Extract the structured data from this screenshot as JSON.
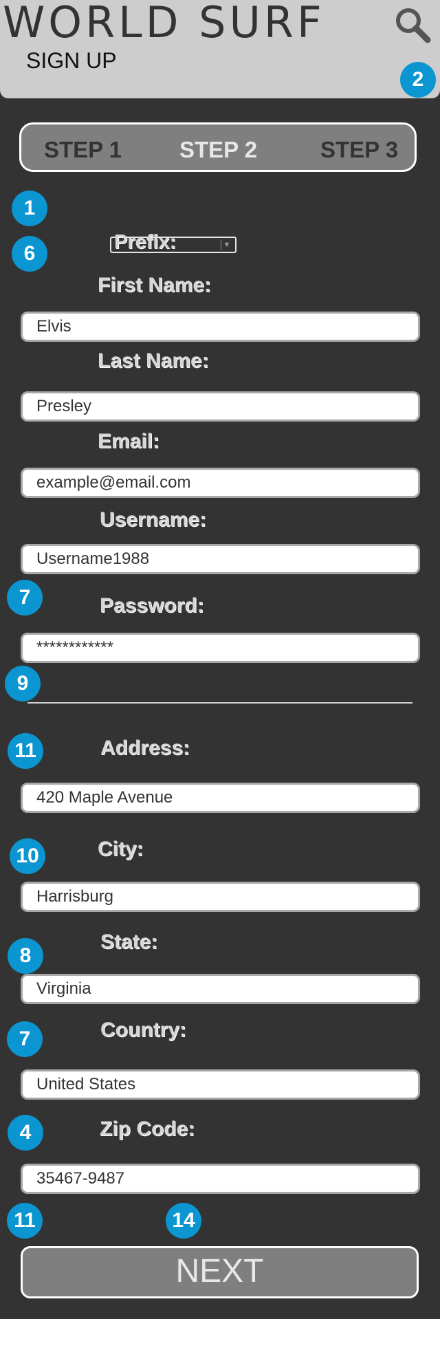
{
  "header": {
    "brand": "WORLD SURF",
    "subtitle": "SIGN UP",
    "search_icon": "search-icon"
  },
  "steps": [
    "STEP 1",
    "STEP 2",
    "STEP 3"
  ],
  "badges": [
    "2",
    "1",
    "6",
    "7",
    "9",
    "11",
    "10",
    "8",
    "7",
    "4",
    "11",
    "14"
  ],
  "form": {
    "prefix_label": "Prefix:",
    "first_name": {
      "label": "First Name:",
      "value": "Elvis"
    },
    "last_name": {
      "label": "Last Name:",
      "value": "Presley"
    },
    "email": {
      "label": "Email:",
      "value": "example@email.com"
    },
    "username": {
      "label": "Username:",
      "value": "Username1988"
    },
    "password": {
      "label": "Password:",
      "value": "************"
    },
    "address": {
      "label": "Address:",
      "value": "420 Maple Avenue"
    },
    "city": {
      "label": "City:",
      "value": "Harrisburg"
    },
    "state": {
      "label": "State:",
      "value": "Virginia"
    },
    "country": {
      "label": "Country:",
      "value": "United States"
    },
    "zip": {
      "label": "Zip Code:",
      "value": "35467-9487"
    }
  },
  "next_label": "NEXT",
  "colors": {
    "background": "#333333",
    "header": "#cdcdcd",
    "badge": "#0b95d1",
    "button": "#7f7f7f"
  }
}
